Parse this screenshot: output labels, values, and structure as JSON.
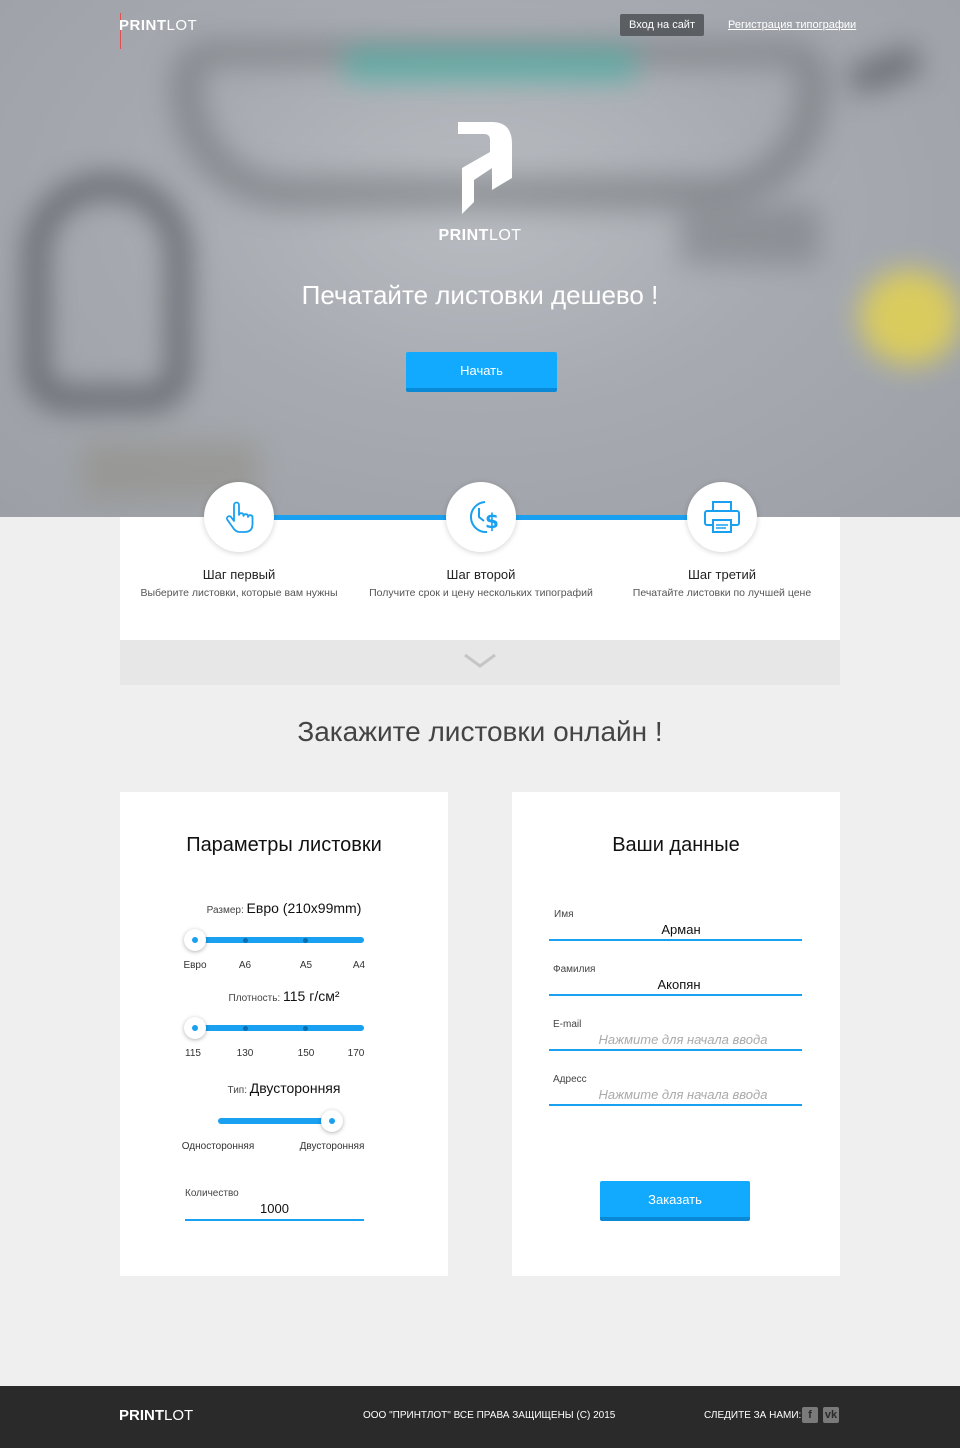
{
  "header": {
    "brand_bold": "PRINT",
    "brand_light": "LOT",
    "login_label": "Вход на сайт",
    "register_label": "Регистрация типографии"
  },
  "hero": {
    "logo_bold": "PRINT",
    "logo_light": "LOT",
    "title": "Печатайте листовки дешево !",
    "start_label": "Начать"
  },
  "steps": [
    {
      "icon": "pointer-hand-icon",
      "title": "Шаг первый",
      "desc": "Выберите листовки, которые вам нужны"
    },
    {
      "icon": "clock-dollar-icon",
      "title": "Шаг второй",
      "desc": "Получите срок и цену нескольких типографий"
    },
    {
      "icon": "printer-icon",
      "title": "Шаг третий",
      "desc": "Печатайте листовки по лучшей цене"
    }
  ],
  "order_section_title": "Закажите листовки онлайн !",
  "params": {
    "title": "Параметры листовки",
    "size": {
      "label": "Размер:",
      "value": "Евро (210x99mm)",
      "options": [
        "Евро",
        "А6",
        "А5",
        "А4"
      ],
      "selected_index": 0
    },
    "density": {
      "label": "Плотность:",
      "value": "115 г/см²",
      "options": [
        "115",
        "130",
        "150",
        "170"
      ],
      "selected_index": 0
    },
    "type": {
      "label": "Тип:",
      "value": "Двусторонняя",
      "options": [
        "Односторонняя",
        "Двусторонняя"
      ],
      "selected_index": 1
    },
    "quantity": {
      "label": "Количество",
      "value": "1000"
    }
  },
  "user": {
    "title": "Ваши данные",
    "first_name": {
      "label": "Имя",
      "value": "Арман"
    },
    "last_name": {
      "label": "Фамилия",
      "value": "Акопян"
    },
    "email": {
      "label": "E-mail",
      "placeholder": "Нажмите для начала ввода"
    },
    "address": {
      "label": "Адресс",
      "placeholder": "Нажмите для начала ввода"
    },
    "submit_label": "Заказать"
  },
  "footer": {
    "brand_bold": "PRINT",
    "brand_light": "LOT",
    "copyright": "ООО \"ПРИНТЛОТ\" ВСЕ ПРАВА ЗАЩИЩЕНЫ  (С)   2015",
    "follow_label": "СЛЕДИТЕ ЗА НАМИ:",
    "social": [
      "f",
      "vk"
    ]
  },
  "colors": {
    "accent": "#11aaff",
    "footer_bg": "#2a2a2a",
    "page_bg": "#efefef"
  }
}
